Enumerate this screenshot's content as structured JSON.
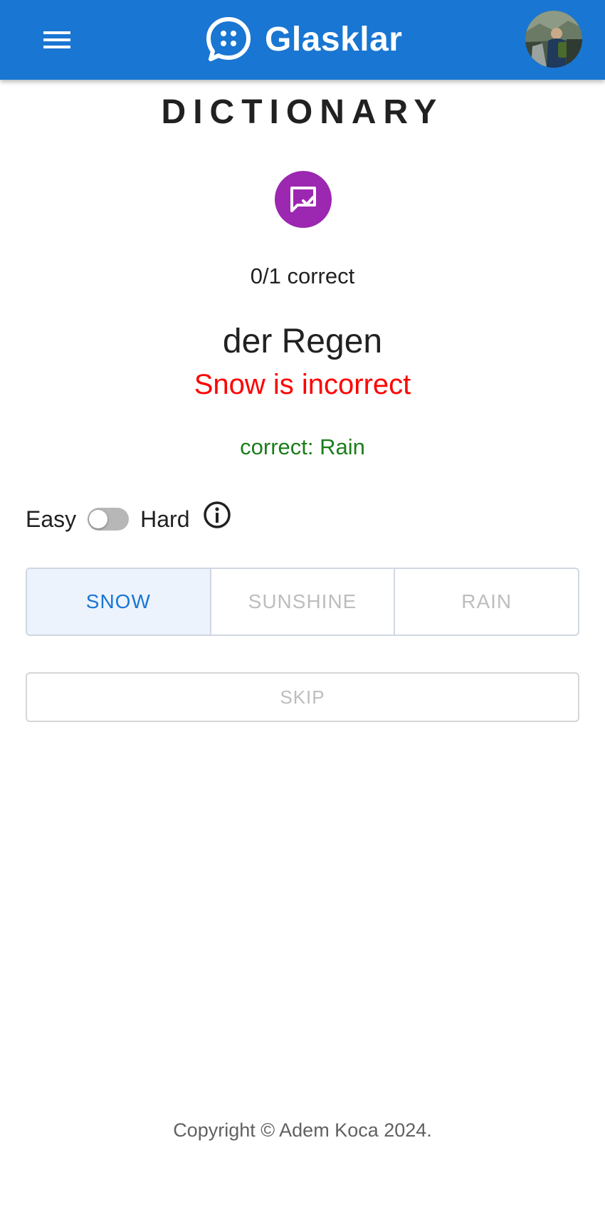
{
  "header": {
    "app_name": "Glasklar",
    "menu_icon": "menu-icon",
    "logo_icon": "chat-bubble-icon",
    "avatar": "user-avatar",
    "brand_color": "#1976d2"
  },
  "quiz": {
    "title": "DICTIONARY",
    "badge_icon": "rate-review-check-icon",
    "badge_color": "#9c27b0",
    "score_text": "0/1 correct",
    "word": "der Regen",
    "feedback_incorrect": "Snow is incorrect",
    "feedback_correct": "correct: Rain",
    "mode": {
      "easy_label": "Easy",
      "hard_label": "Hard",
      "hard_enabled": false,
      "info_icon": "info-icon"
    },
    "options": [
      {
        "label": "SNOW",
        "selected": true
      },
      {
        "label": "SUNSHINE",
        "selected": false
      },
      {
        "label": "RAIN",
        "selected": false
      }
    ],
    "skip_label": "SKIP"
  },
  "footer": {
    "copyright": "Copyright © Adem Koca 2024."
  }
}
